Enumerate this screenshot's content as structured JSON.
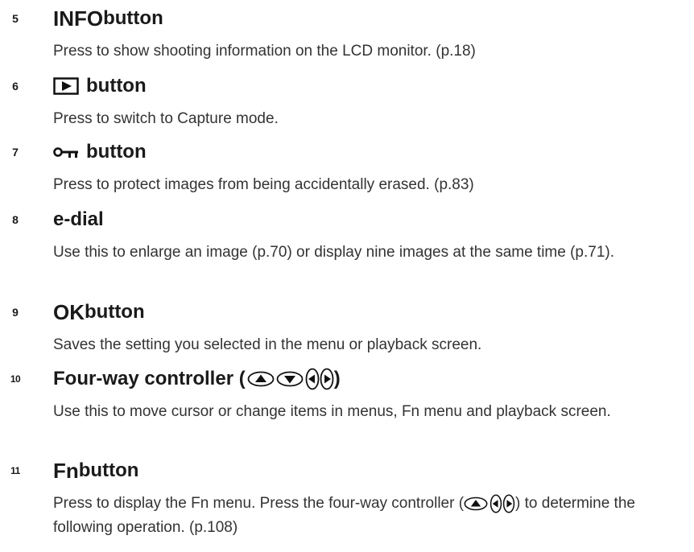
{
  "items": [
    {
      "num": "5",
      "title_bold": "INFO",
      "title_rest": " button",
      "desc": "Press to show shooting information on the LCD monitor. (p.18)"
    },
    {
      "num": "6",
      "icon": "playback-icon",
      "title_rest": "button",
      "desc": "Press to switch to Capture mode."
    },
    {
      "num": "7",
      "icon": "protect-key-icon",
      "title_rest": "button",
      "desc": "Press to protect images from being accidentally erased. (p.83)"
    },
    {
      "num": "8",
      "title_rest": "e-dial",
      "desc": "Use this to enlarge an image (p.70) or display nine images at the same time (p.71)."
    },
    {
      "num": "9",
      "title_bold": "OK",
      "title_rest": " button",
      "desc": "Saves the setting you selected in the menu or playback screen."
    },
    {
      "num": "10",
      "title_rest": "Four-way controller (",
      "title_after": ")",
      "desc": "Use this to move cursor or change items in menus, Fn menu and playback screen."
    },
    {
      "num": "11",
      "title_bold": "Fn",
      "title_rest": " button",
      "desc_before": "Press to display the Fn menu. Press the four-way controller (",
      "desc_after": ") to determine the following operation. (p.108)"
    }
  ],
  "icons": [
    "playback-icon",
    "protect-key-icon",
    "up-arrow-icon",
    "down-arrow-icon",
    "left-arrow-icon",
    "right-arrow-icon"
  ]
}
